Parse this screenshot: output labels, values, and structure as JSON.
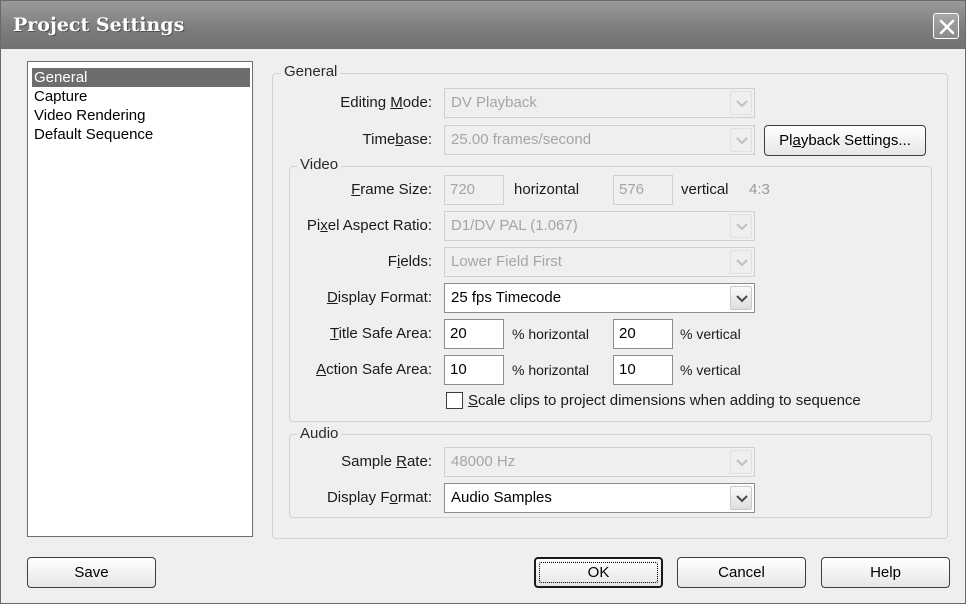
{
  "window": {
    "title": "Project Settings"
  },
  "categories": [
    {
      "label": "General",
      "selected": true
    },
    {
      "label": "Capture",
      "selected": false
    },
    {
      "label": "Video Rendering",
      "selected": false
    },
    {
      "label": "Default Sequence",
      "selected": false
    }
  ],
  "general": {
    "group_title": "General",
    "editing_mode": {
      "pre": "Editing ",
      "key": "M",
      "post": "ode:",
      "value": "DV Playback"
    },
    "timebase": {
      "pre": "Time",
      "key": "b",
      "post": "ase:",
      "value": "25.00 frames/second"
    },
    "playback_settings": {
      "pre": "Pl",
      "key": "a",
      "post": "yback Settings..."
    }
  },
  "video": {
    "group_title": "Video",
    "frame_size": {
      "key": "F",
      "post": "rame Size:",
      "horizontal_value": "720",
      "horizontal_label": "horizontal",
      "vertical_value": "576",
      "vertical_label": "vertical",
      "aspect": "4:3"
    },
    "pixel_aspect_ratio": {
      "pre": "Pi",
      "key": "x",
      "post": "el Aspect Ratio:",
      "value": "D1/DV PAL (1.067)"
    },
    "fields": {
      "pre": "F",
      "key": "i",
      "post": "elds:",
      "value": "Lower Field First"
    },
    "display_format": {
      "key": "D",
      "post": "isplay Format:",
      "value": "25 fps Timecode"
    },
    "title_safe_area": {
      "key": "T",
      "post": "itle Safe Area:",
      "horizontal": "20",
      "horizontal_label": "% horizontal",
      "vertical": "20",
      "vertical_label": "% vertical"
    },
    "action_safe_area": {
      "key": "A",
      "post": "ction Safe Area:",
      "horizontal": "10",
      "horizontal_label": "% horizontal",
      "vertical": "10",
      "vertical_label": "% vertical"
    },
    "scale_clips": {
      "key": "S",
      "post": "cale clips to project dimensions when adding to sequence",
      "checked": false
    }
  },
  "audio": {
    "group_title": "Audio",
    "sample_rate": {
      "pre": "Sample ",
      "key": "R",
      "post": "ate:",
      "value": "48000 Hz"
    },
    "display_format": {
      "pre": "Display F",
      "key": "o",
      "post": "rmat:",
      "value": "Audio Samples"
    }
  },
  "buttons": {
    "save": "Save",
    "ok": "OK",
    "cancel": "Cancel",
    "help": "Help"
  }
}
